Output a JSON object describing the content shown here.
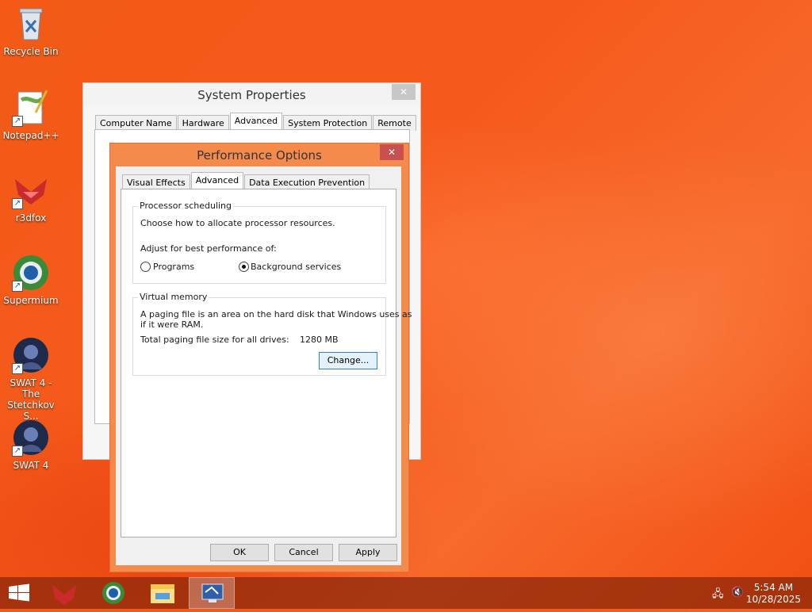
{
  "desktop": {
    "icons": [
      {
        "label": "Recycle Bin",
        "icon": "recycle-bin-icon"
      },
      {
        "label": "Notepad++",
        "icon": "notepadpp-icon"
      },
      {
        "label": "r3dfox",
        "icon": "r3dfox-icon"
      },
      {
        "label": "Supermium",
        "icon": "supermium-icon"
      },
      {
        "label": "SWAT 4 - The Stetchkov S...",
        "icon": "swat4-icon"
      },
      {
        "label": "SWAT 4",
        "icon": "swat4-icon"
      }
    ]
  },
  "system_properties": {
    "title": "System Properties",
    "tabs": [
      "Computer Name",
      "Hardware",
      "Advanced",
      "System Protection",
      "Remote"
    ],
    "active_tab": "Advanced"
  },
  "performance_options": {
    "title": "Performance Options",
    "tabs": [
      "Visual Effects",
      "Advanced",
      "Data Execution Prevention"
    ],
    "active_tab": "Advanced",
    "processor_scheduling": {
      "legend": "Processor scheduling",
      "description": "Choose how to allocate processor resources.",
      "adjust_label": "Adjust for best performance of:",
      "options": [
        "Programs",
        "Background services"
      ],
      "selected": "Background services"
    },
    "virtual_memory": {
      "legend": "Virtual memory",
      "description_line1": "A paging file is an area on the hard disk that Windows uses as",
      "description_line2": "if it were RAM.",
      "total_label": "Total paging file size for all drives:",
      "total_value": "1280 MB",
      "change_button": "Change..."
    },
    "buttons": {
      "ok": "OK",
      "cancel": "Cancel",
      "apply": "Apply"
    }
  },
  "taskbar": {
    "items": [
      "start-icon",
      "r3dfox-icon",
      "supermium-icon",
      "file-explorer-icon",
      "system-properties-icon"
    ],
    "time": "5:54 AM",
    "date": "10/28/2025"
  },
  "colors": {
    "accent": "#f58a4d",
    "desktop": "#f25a16"
  }
}
